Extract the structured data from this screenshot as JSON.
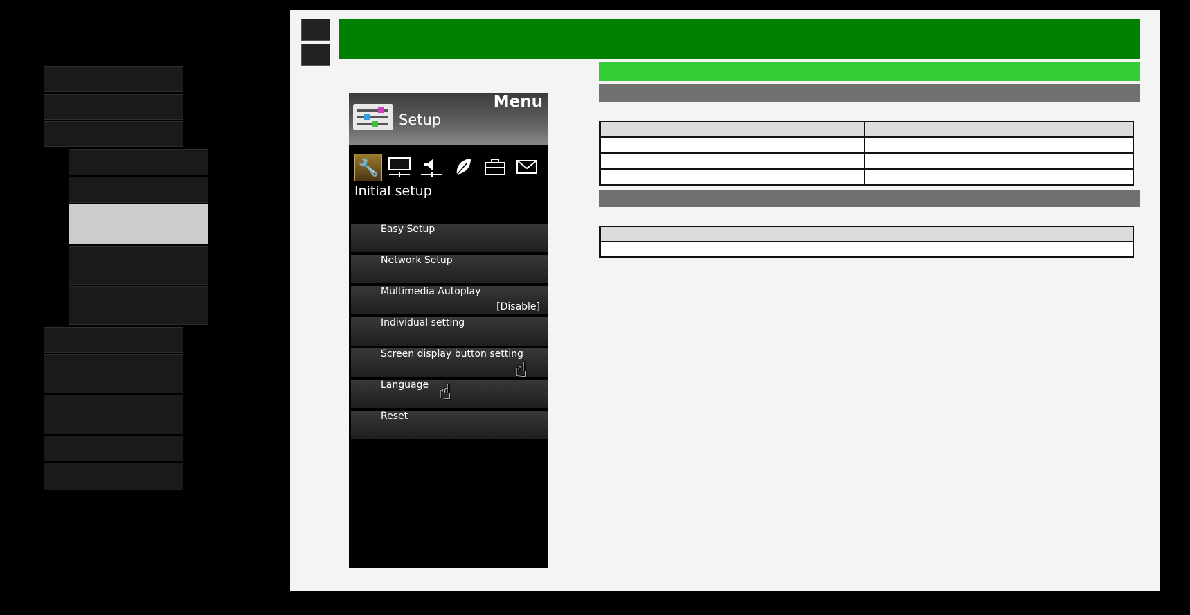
{
  "tv_menu": {
    "menu_label": "Menu",
    "setup_label": "Setup",
    "section_label": "Initial setup",
    "tab_icons": [
      "wrench-icon",
      "monitor-icon",
      "speaker-icon",
      "leaf-icon",
      "toolbox-icon",
      "envelope-icon"
    ],
    "items": [
      {
        "label": "Easy Setup",
        "value": ""
      },
      {
        "label": "Network Setup",
        "value": ""
      },
      {
        "label": "Multimedia Autoplay",
        "value": "[Disable]"
      },
      {
        "label": "Individual setting",
        "value": ""
      },
      {
        "label": "Screen display button setting",
        "value": ""
      },
      {
        "label": "Language",
        "value": ""
      },
      {
        "label": "Reset",
        "value": ""
      }
    ]
  },
  "colors": {
    "title_banner": "#008000",
    "sub_banner": "#34cc34",
    "section_bar": "#707070",
    "nav_active": "#cccccc"
  }
}
